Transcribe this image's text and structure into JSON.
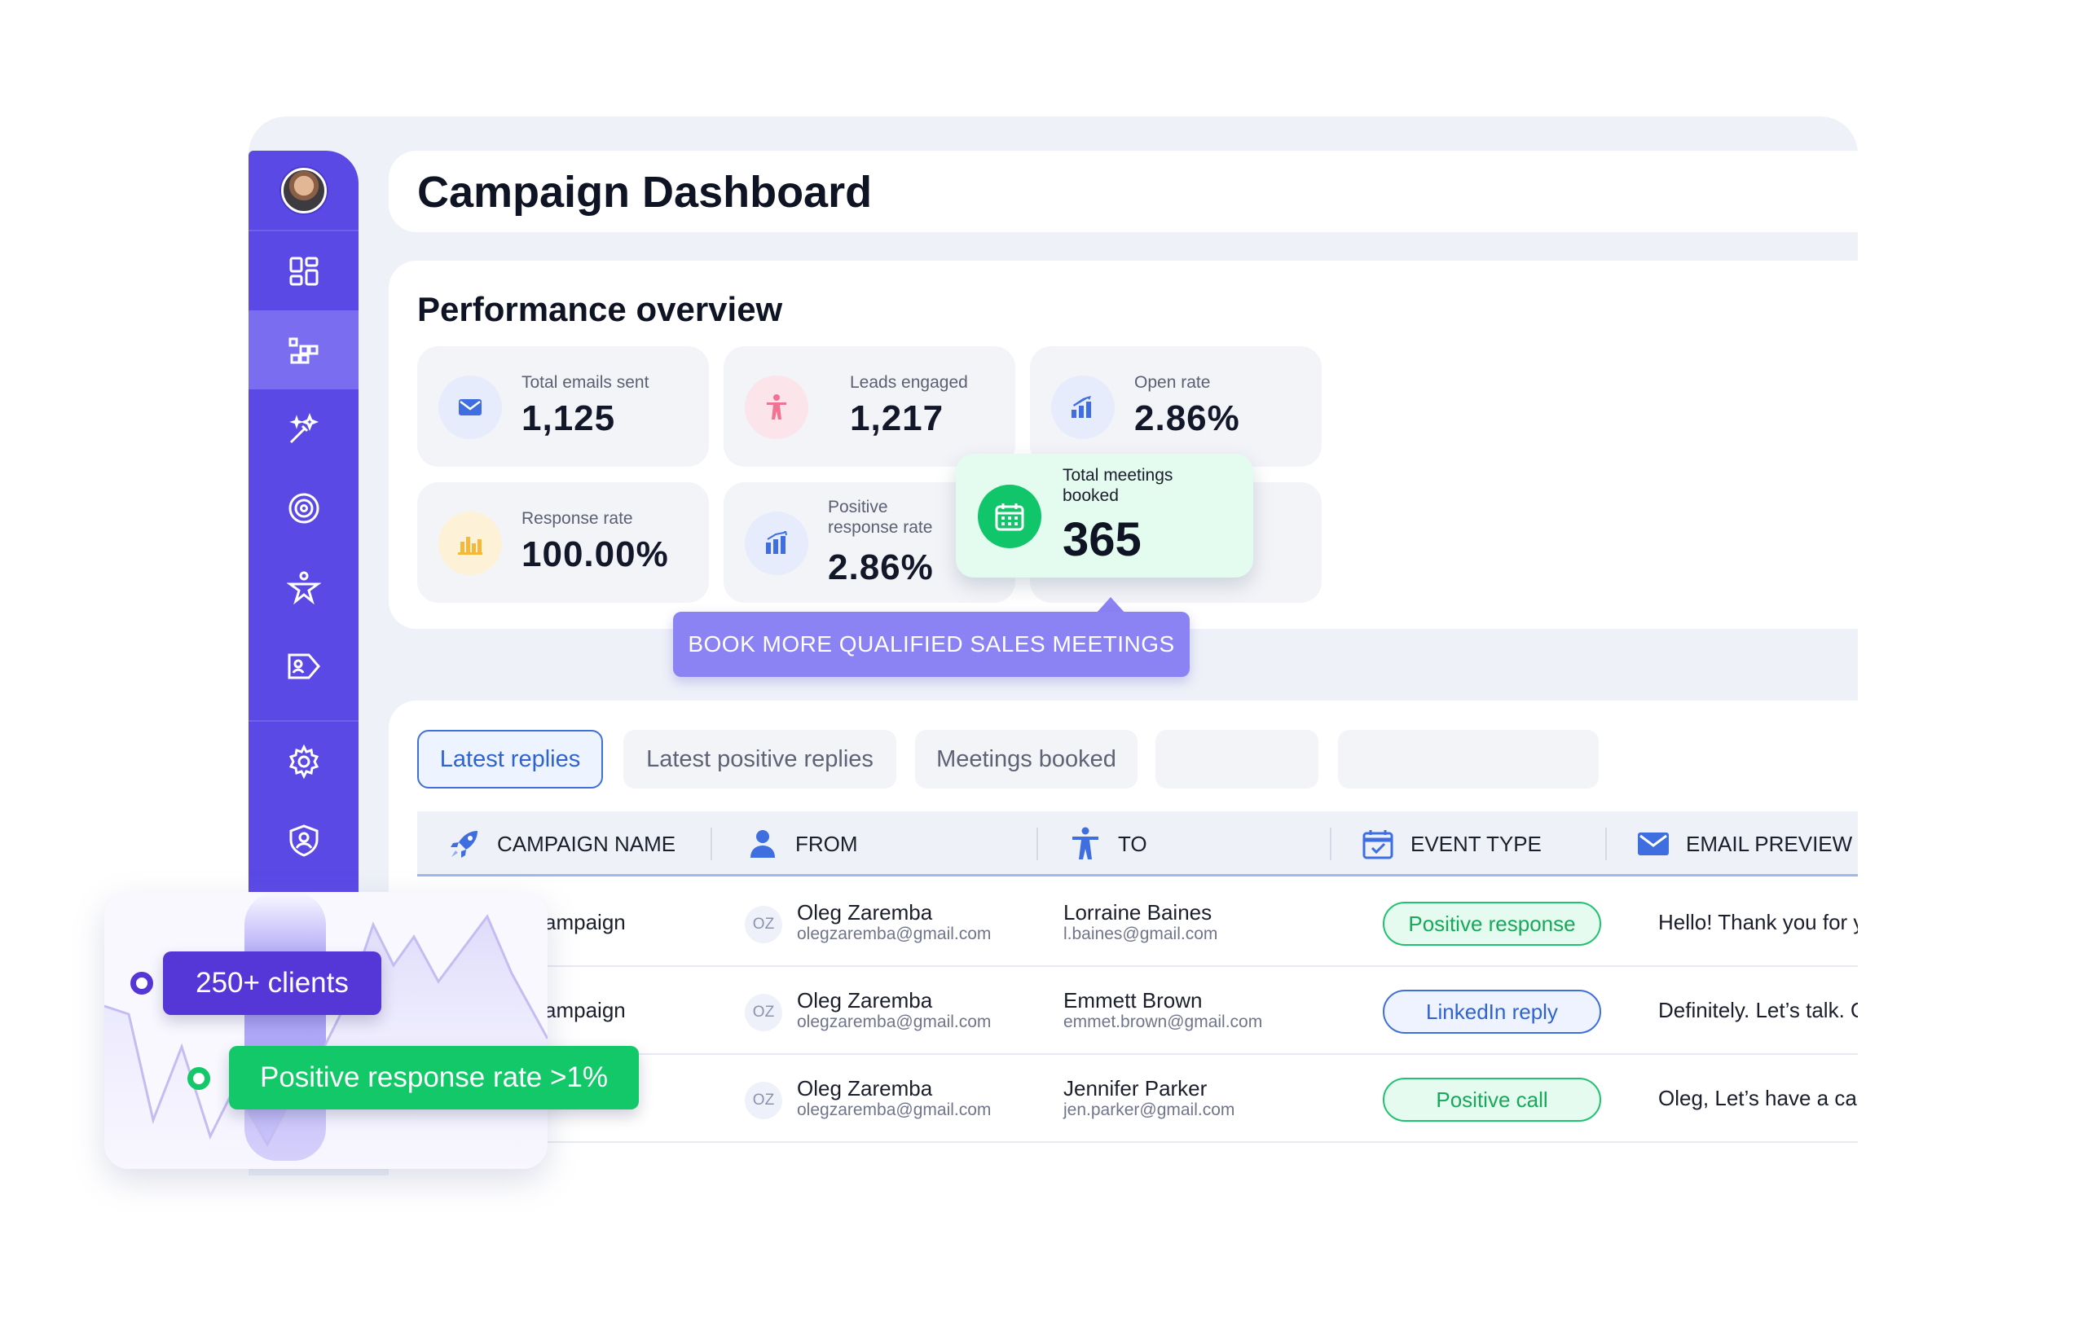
{
  "page_title": "Campaign Dashboard",
  "performance": {
    "title": "Performance overview",
    "stats": [
      {
        "label": "Total emails sent",
        "value": "1,125",
        "icon": "envelope-icon"
      },
      {
        "label": "Leads engaged",
        "value": "1,217",
        "icon": "person-icon"
      },
      {
        "label": "Open rate",
        "value": "2.86%",
        "icon": "growth-chart-icon"
      },
      {
        "label": "Response rate",
        "value": "100.00%",
        "icon": "bar-chart-icon"
      },
      {
        "label": "Positive response rate",
        "value": "2.86%",
        "icon": "bar-chart-icon"
      }
    ],
    "meetings": {
      "label": "Total meetings booked",
      "value": "365",
      "icon": "calendar-icon"
    },
    "cta": "BOOK MORE QUALIFIED SALES MEETINGS"
  },
  "tabs": [
    "Latest replies",
    "Latest positive replies",
    "Meetings booked"
  ],
  "table": {
    "columns": [
      "CAMPAIGN NAME",
      "FROM",
      "TO",
      "EVENT TYPE",
      "EMAIL PREVIEW"
    ],
    "rows": [
      {
        "campaign": "ampaign",
        "initials": "OZ",
        "from_name": "Oleg Zaremba",
        "from_email": "olegzaremba@gmail.com",
        "to_name": "Lorraine Baines",
        "to_email": "l.baines@gmail.com",
        "event": "Positive response",
        "preview": "Hello! Thank you for your"
      },
      {
        "campaign": "ampaign",
        "initials": "OZ",
        "from_name": "Oleg Zaremba",
        "from_email": "olegzaremba@gmail.com",
        "to_name": "Emmett Brown",
        "to_email": "emmet.brown@gmail.com",
        "event": "LinkedIn reply",
        "preview": "Definitely. Let’s talk. On Tu"
      },
      {
        "campaign": "",
        "initials": "OZ",
        "from_name": "Oleg Zaremba",
        "from_email": "olegzaremba@gmail.com",
        "to_name": "Jennifer Parker",
        "to_email": "jen.parker@gmail.com",
        "event": "Positive call",
        "preview": "Oleg, Let’s have a call nex"
      }
    ]
  },
  "overlay": {
    "clients": "250+ clients",
    "positive_rate": "Positive response rate >1%"
  },
  "colors": {
    "sidebar": "#5b49e6",
    "accent_blue": "#3f6fd8",
    "accent_green": "#12c868",
    "badge_purple": "#5536d6",
    "cta": "#8b82f3"
  }
}
